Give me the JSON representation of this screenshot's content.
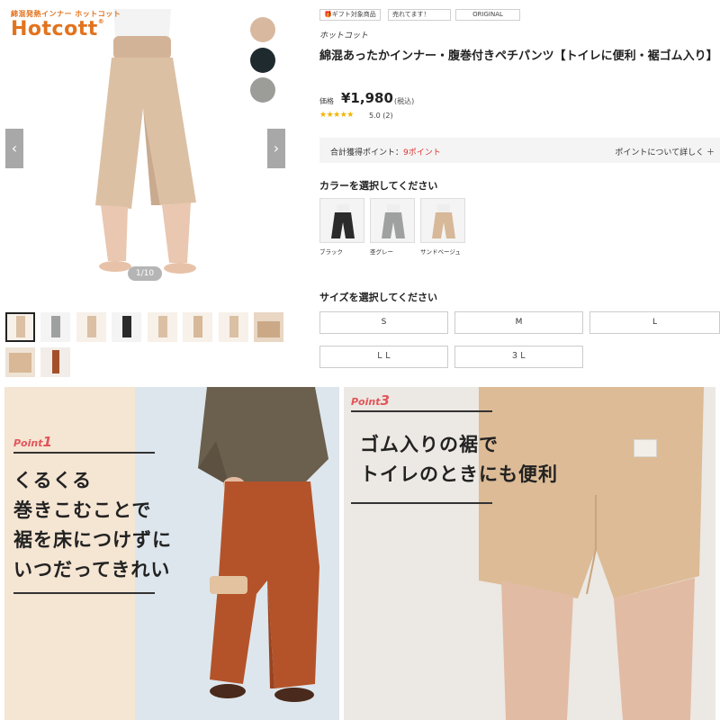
{
  "logo": {
    "subtitle": "綿混発熱インナー ホットコット",
    "name": "Hotcott"
  },
  "gallery": {
    "counter": "1/10",
    "prev_icon": "chevron-left-icon",
    "next_icon": "chevron-right-icon",
    "swatch_colors": [
      "#d8b9a0",
      "#1f2a2e",
      "#9c9d99"
    ]
  },
  "tags": [
    "ギフト対象商品",
    "売れてます！",
    "ORIGINAL"
  ],
  "product": {
    "brand": "ホットコット",
    "title": "綿混あったかインナー・腹巻付きペチパンツ【トイレに便利・裾ゴム入り】",
    "price_label": "価格",
    "price": "¥1,980",
    "tax": "(税込)",
    "stars": "★★★★★",
    "rating": "5.0",
    "review_count": "(2)"
  },
  "points": {
    "label": "合計獲得ポイント：",
    "value": "9ポイント",
    "link": "ポイントについて詳しく ＋"
  },
  "color_section": {
    "title": "カラーを選択してください",
    "options": [
      {
        "name": "ブラック",
        "color": "#2b2b2b"
      },
      {
        "name": "杢グレー",
        "color": "#9fa0a0"
      },
      {
        "name": "サンドベージュ",
        "color": "#d7b898"
      }
    ]
  },
  "size_section": {
    "title": "サイズを選択してください",
    "sizes": [
      "S",
      "M",
      "L",
      "ＬＬ",
      "３Ｌ"
    ]
  },
  "banner1": {
    "point_prefix": "Point",
    "point_num": "1",
    "lines": [
      "くるくる",
      "巻きこむことで",
      "裾を床につけずに",
      "いつだってきれい"
    ]
  },
  "banner2": {
    "point_prefix": "Point",
    "point_num": "3",
    "lines": [
      "ゴム入りの裾で",
      "トイレのときにも便利"
    ]
  }
}
